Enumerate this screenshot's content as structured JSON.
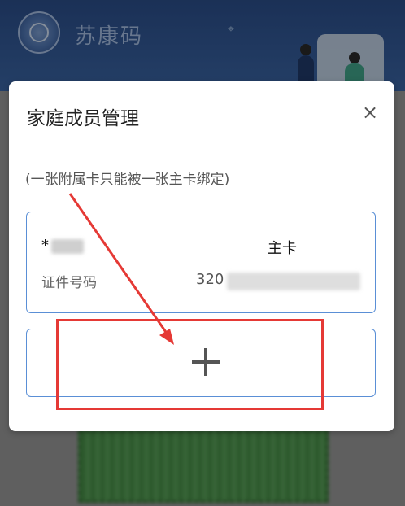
{
  "background_app": {
    "title": "苏康码",
    "logo_icon": "emblem-logo-icon",
    "pin_icon": "map-pin-icon"
  },
  "modal": {
    "title": "家庭成员管理",
    "close_label": "×",
    "note": "(一张附属卡只能被一张主卡绑定)",
    "member": {
      "name_prefix": "*",
      "role": "主卡",
      "id_label": "证件号码",
      "id_value": "320"
    },
    "add_label_icon": "plus-icon"
  },
  "annotation": {
    "color": "#e53935"
  }
}
